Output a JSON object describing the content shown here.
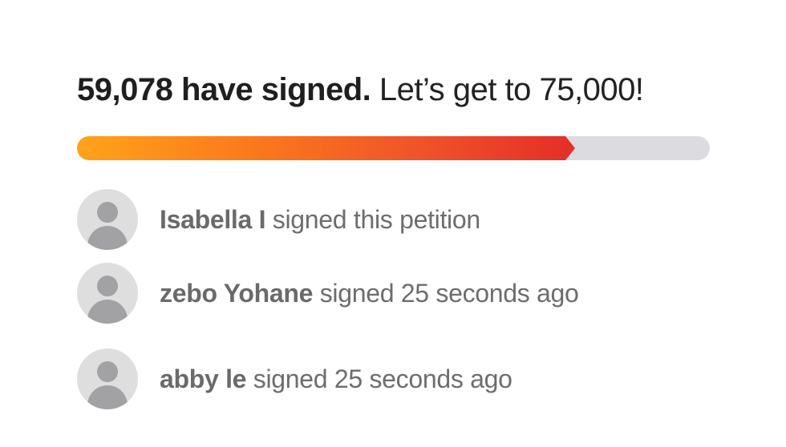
{
  "headline": {
    "count_text": "59,078 have signed.",
    "goal_text": "Let’s get to 75,000!"
  },
  "progress": {
    "signed": 59078,
    "goal": 75000,
    "fraction": 0.7877,
    "colors": {
      "start": "#ffa31a",
      "end": "#e53028",
      "track": "#dcdbe0"
    }
  },
  "signers": [
    {
      "name": "Isabella I",
      "action": "signed this petition",
      "avatar_icon": "default-user-icon"
    },
    {
      "name": "zebo Yohane",
      "action": "signed 25 seconds ago",
      "avatar_icon": "default-user-icon"
    },
    {
      "name": "abby le",
      "action": "signed 25 seconds ago",
      "avatar_icon": "default-user-icon"
    }
  ]
}
